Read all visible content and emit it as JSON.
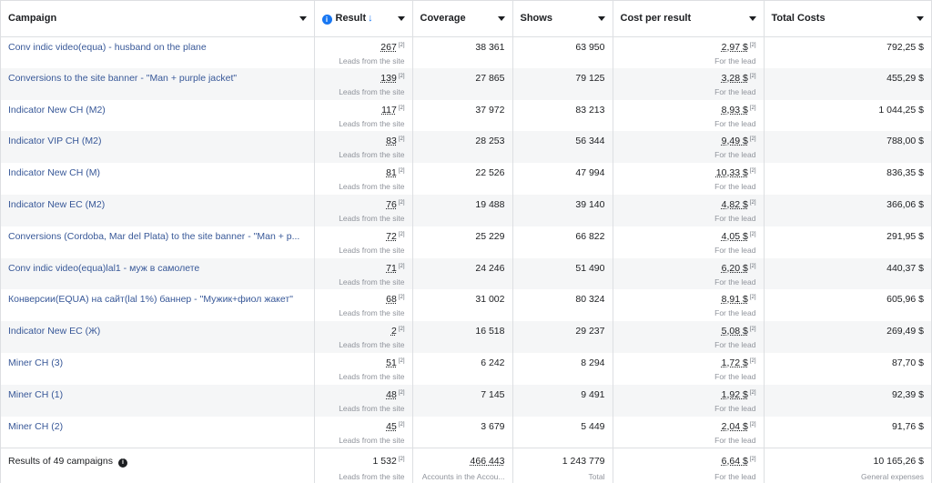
{
  "columns": {
    "campaign": "Campaign",
    "result": "Result",
    "sort_arrow": "↓",
    "coverage": "Coverage",
    "shows": "Shows",
    "cost_per_result": "Cost per result",
    "total_costs": "Total Costs"
  },
  "sub_labels": {
    "result": "Leads from the site",
    "cost": "For the lead"
  },
  "sup_mark": "[2]",
  "rows": [
    {
      "campaign": "Conv indic video(equa) - husband on the plane",
      "result": "267",
      "coverage": "38 361",
      "shows": "63 950",
      "cost": "2,97 $",
      "total": "792,25 $"
    },
    {
      "campaign": "Conversions to the site banner - \"Man + purple jacket\"",
      "result": "139",
      "coverage": "27 865",
      "shows": "79 125",
      "cost": "3,28 $",
      "total": "455,29 $"
    },
    {
      "campaign": "Indicator New CH (M2)",
      "result": "117",
      "coverage": "37 972",
      "shows": "83 213",
      "cost": "8,93 $",
      "total": "1 044,25 $"
    },
    {
      "campaign": "Indicator VIP CH (M2)",
      "result": "83",
      "coverage": "28 253",
      "shows": "56 344",
      "cost": "9,49 $",
      "total": "788,00 $"
    },
    {
      "campaign": "Indicator New CH (M)",
      "result": "81",
      "coverage": "22 526",
      "shows": "47 994",
      "cost": "10,33 $",
      "total": "836,35 $"
    },
    {
      "campaign": "Indicator New EC (M2)",
      "result": "76",
      "coverage": "19 488",
      "shows": "39 140",
      "cost": "4,82 $",
      "total": "366,06 $"
    },
    {
      "campaign": "Conversions (Cordoba, Mar del Plata) to the site banner - \"Man + p...",
      "result": "72",
      "coverage": "25 229",
      "shows": "66 822",
      "cost": "4,05 $",
      "total": "291,95 $"
    },
    {
      "campaign": "Conv indic video(equa)lal1 - муж в самолете",
      "result": "71",
      "coverage": "24 246",
      "shows": "51 490",
      "cost": "6,20 $",
      "total": "440,37 $"
    },
    {
      "campaign": "Конверсии(EQUA) на сайт(lal 1%) баннер - \"Мужик+фиол жакет\"",
      "result": "68",
      "coverage": "31 002",
      "shows": "80 324",
      "cost": "8,91 $",
      "total": "605,96 $"
    },
    {
      "campaign": "Indicator New EC (Ж)",
      "result": "2",
      "coverage": "16 518",
      "shows": "29 237",
      "cost": "5,08 $",
      "total": "269,49 $"
    },
    {
      "campaign": "Miner CH (3)",
      "result": "51",
      "coverage": "6 242",
      "shows": "8 294",
      "cost": "1,72 $",
      "total": "87,70 $"
    },
    {
      "campaign": "Miner CH (1)",
      "result": "48",
      "coverage": "7 145",
      "shows": "9 491",
      "cost": "1,92 $",
      "total": "92,39 $"
    },
    {
      "campaign": "Miner CH (2)",
      "result": "45",
      "coverage": "3 679",
      "shows": "5 449",
      "cost": "2,04 $",
      "total": "91,76 $"
    }
  ],
  "footer": {
    "label": "Results of 49 campaigns",
    "result": "1 532",
    "result_sub": "Leads from the site",
    "coverage": "466 443",
    "coverage_sub": "Accounts in the Accou...",
    "shows": "1 243 779",
    "shows_sub": "Total",
    "cost": "6,64 $",
    "cost_sub": "For the lead",
    "total": "10 165,26 $",
    "total_sub": "General expenses"
  },
  "colors": {
    "link": "#385898",
    "accent": "#1877f2",
    "stripe": "#f5f6f7",
    "border": "#dddfe2"
  },
  "icons": [
    "info-icon",
    "sort-down-icon",
    "chevron-down-icon"
  ]
}
